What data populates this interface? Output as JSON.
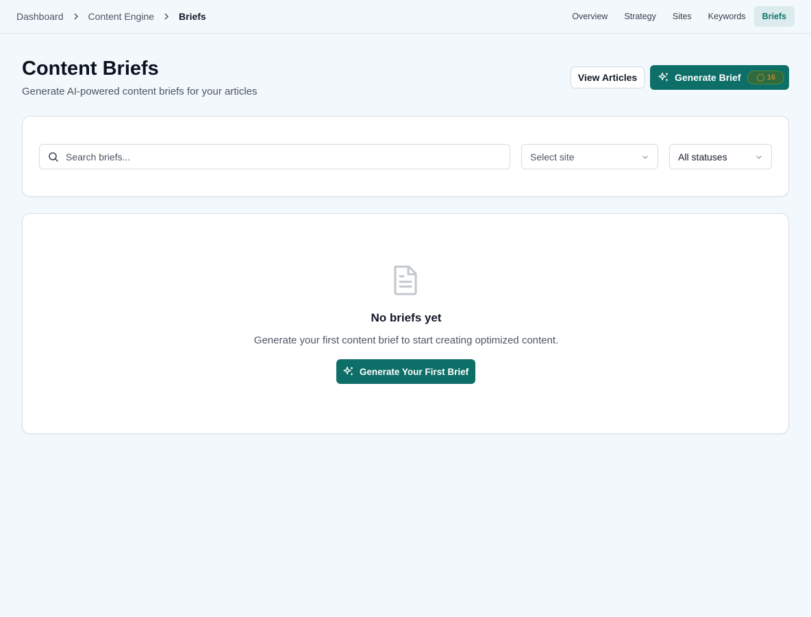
{
  "breadcrumb": {
    "items": [
      "Dashboard",
      "Content Engine"
    ],
    "current": "Briefs"
  },
  "topnav": {
    "items": [
      "Overview",
      "Strategy",
      "Sites",
      "Keywords",
      "Briefs"
    ],
    "active": "Briefs"
  },
  "header": {
    "title": "Content Briefs",
    "subtitle": "Generate AI-powered content briefs for your articles",
    "view_articles_label": "View Articles",
    "generate_label": "Generate Brief",
    "cost": "16"
  },
  "filters": {
    "search_placeholder": "Search briefs...",
    "site_select": "Select site",
    "status_select": "All statuses"
  },
  "empty_state": {
    "title": "No briefs yet",
    "description": "Generate your first content brief to start creating optimized content.",
    "button_label": "Generate Your First Brief"
  },
  "colors": {
    "primary": "#0d6f68",
    "active_nav_bg": "#dcebed",
    "page_bg": "#f2f8fb"
  },
  "icons": {
    "breadcrumb_separator": "chevron-right-icon",
    "generate": "sparkles-icon",
    "search": "search-icon",
    "select": "chevron-down-icon",
    "empty": "file-text-icon",
    "cost": "coin-icon"
  }
}
